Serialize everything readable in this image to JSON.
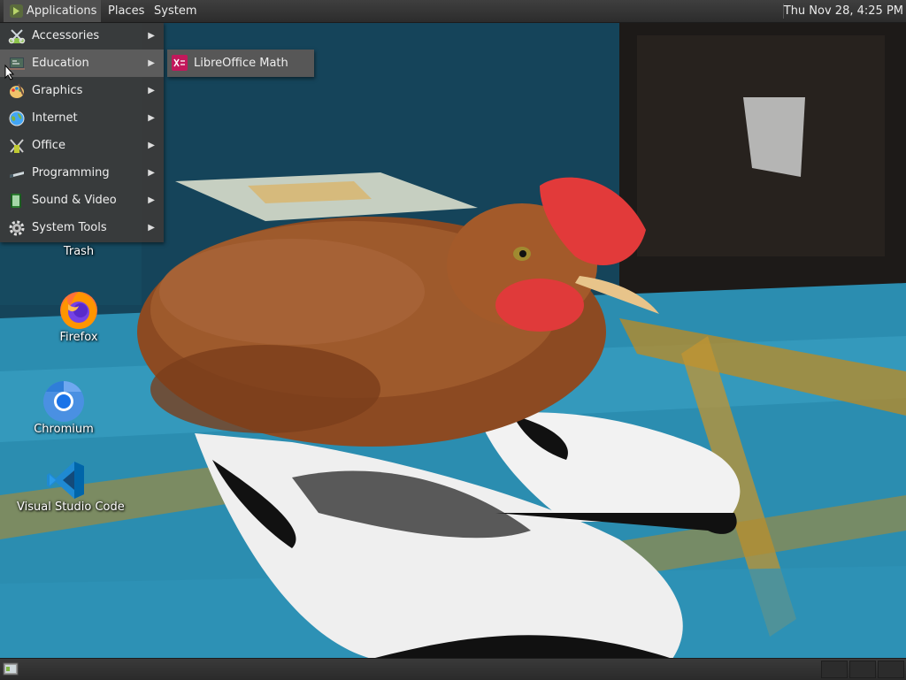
{
  "top_panel": {
    "applications_label": "Applications",
    "places_label": "Places",
    "system_label": "System",
    "clock": "Thu Nov 28,  4:25 PM"
  },
  "app_menu": {
    "items": [
      {
        "label": "Accessories",
        "icon": "accessories-icon"
      },
      {
        "label": "Education",
        "icon": "education-icon"
      },
      {
        "label": "Graphics",
        "icon": "graphics-icon"
      },
      {
        "label": "Internet",
        "icon": "internet-icon"
      },
      {
        "label": "Office",
        "icon": "office-icon"
      },
      {
        "label": "Programming",
        "icon": "programming-icon"
      },
      {
        "label": "Sound & Video",
        "icon": "sound-video-icon"
      },
      {
        "label": "System Tools",
        "icon": "system-tools-icon"
      }
    ],
    "submenu_arrow": "▶",
    "active_item": "Education"
  },
  "education_submenu": {
    "items": [
      {
        "label": "LibreOffice Math",
        "icon": "libreoffice-math-icon"
      }
    ]
  },
  "desktop_icons": [
    {
      "label": "Trash",
      "icon": "trash-icon"
    },
    {
      "label": "Firefox",
      "icon": "firefox-icon"
    },
    {
      "label": "Chromium",
      "icon": "chromium-icon"
    },
    {
      "label": "Visual Studio Code",
      "icon": "vscode-icon"
    }
  ],
  "colors": {
    "panel": "#333333",
    "menu_bg": "#3a3a3a",
    "menu_hover": "#5c5c5c",
    "text": "#eeeeee"
  }
}
